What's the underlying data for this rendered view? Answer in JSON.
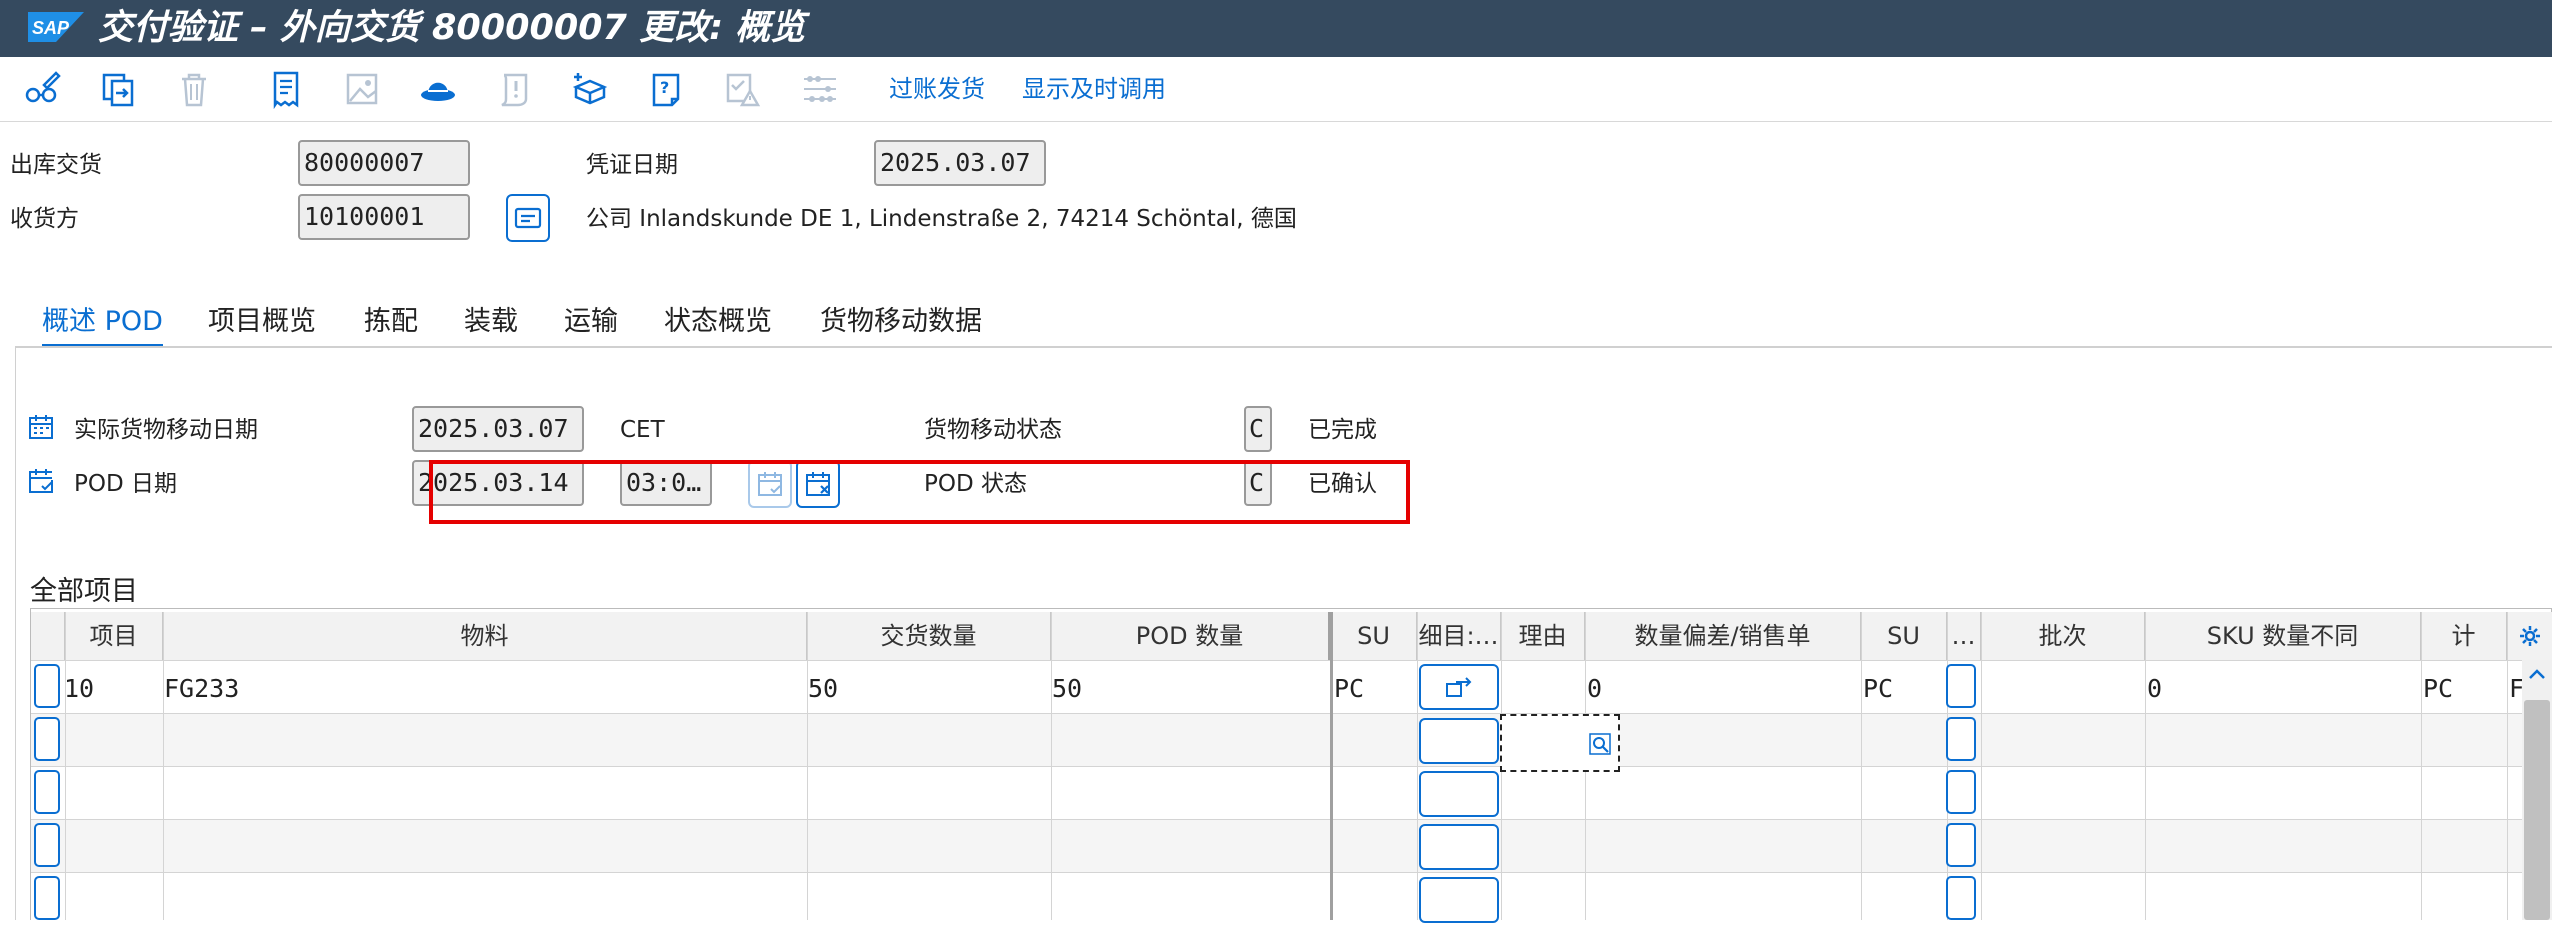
{
  "window": {
    "logo_text": "SAP",
    "title": "交付验证 – 外向交货 80000007 更改: 概览"
  },
  "toolbar": {
    "icons": [
      "glasses-pencil-icon",
      "copy-arrow-icon",
      "trash-icon",
      "receipt-icon",
      "image-icon",
      "hat-icon",
      "alert-scroll-icon",
      "add-package-icon",
      "help-document-icon",
      "checklist-warning-icon",
      "abacus-icon"
    ],
    "post_goods_issue": "过账发货",
    "show_time_usage": "显示及时调用"
  },
  "header": {
    "outbound_delivery_label": "出库交货",
    "outbound_delivery_value": "80000007",
    "document_date_label": "凭证日期",
    "document_date_value": "2025.03.07",
    "ship_to_label": "收货方",
    "ship_to_value": "10100001",
    "ship_to_address": "公司 Inlandskunde DE 1, Lindenstraße 2, 74214 Schöntal, 德国"
  },
  "tabs": [
    "概述 POD",
    "项目概览",
    "拣配",
    "装载",
    "运输",
    "状态概览",
    "货物移动数据"
  ],
  "overview": {
    "actual_gm_date_label": "实际货物移动日期",
    "actual_gm_date_value": "2025.03.07",
    "timezone": "CET",
    "gm_status_label": "货物移动状态",
    "gm_status_code": "C",
    "gm_status_text": "已完成",
    "pod_date_label": "POD 日期",
    "pod_date_value": "2025.03.14",
    "pod_time_value": "03:0…",
    "pod_status_label": "POD 状态",
    "pod_status_code": "C",
    "pod_status_text": "已确认"
  },
  "items": {
    "title": "全部项目",
    "columns": [
      "项目",
      "物料",
      "交货数量",
      "POD 数量",
      "SU",
      "细目:…",
      "理由",
      "数量偏差/销售单",
      "SU",
      "…",
      "批次",
      "SKU 数量不同",
      "计",
      ""
    ],
    "rows": [
      {
        "item": "10",
        "material": "FG233",
        "delivery_qty": "50",
        "pod_qty": "50",
        "su": "PC",
        "diff_qty": "0",
        "su2": "PC",
        "sku_diff": "0",
        "unit": "PC",
        "extra": "FE"
      }
    ]
  },
  "colors": {
    "title_bar": "#354a5f",
    "accent": "#0a6ed1",
    "highlight": "#e50000"
  }
}
